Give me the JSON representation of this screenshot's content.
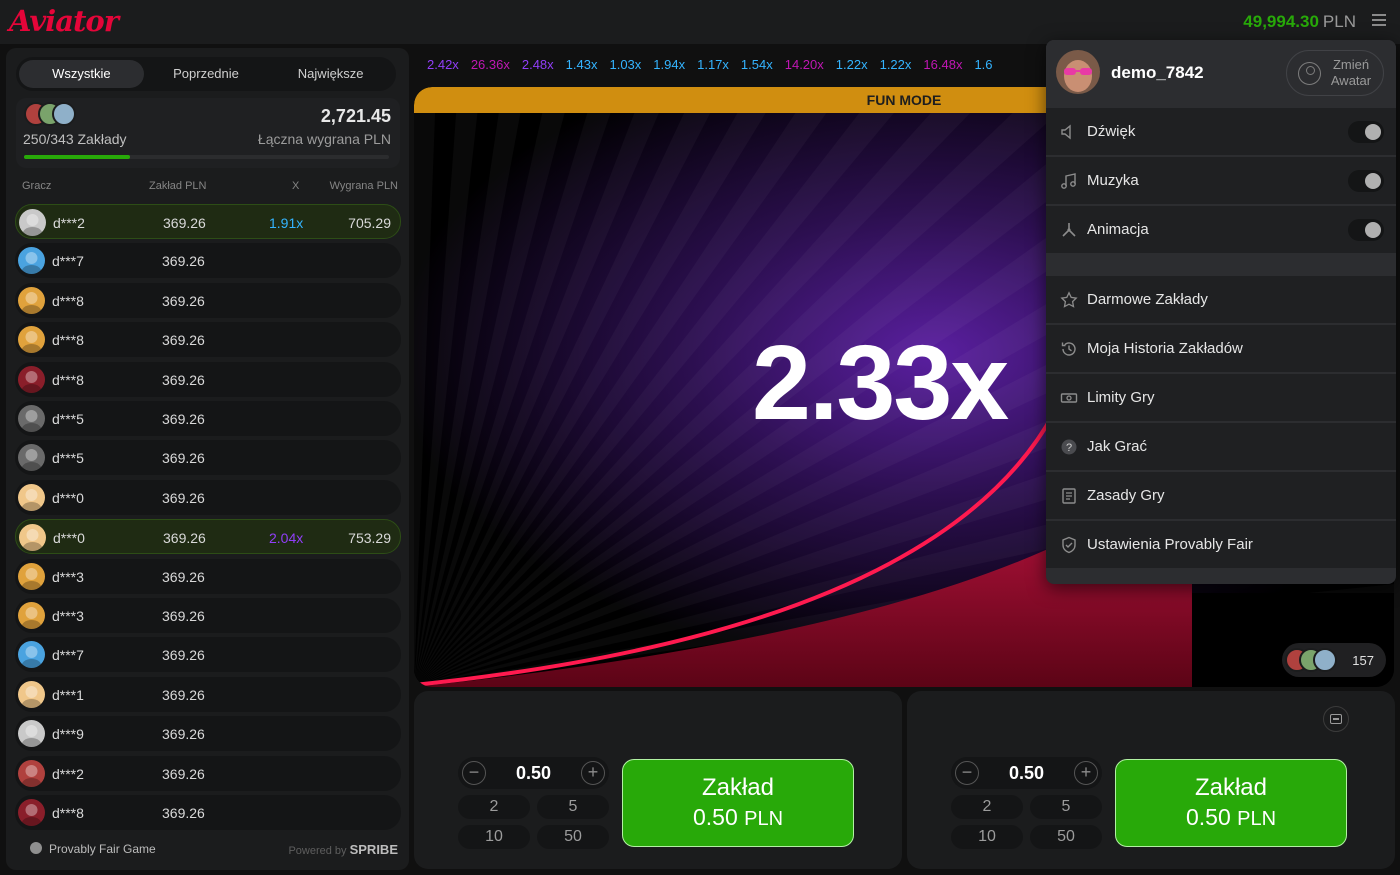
{
  "app": {
    "logo": "Aviator"
  },
  "header": {
    "balance": "49,994.30",
    "currency": "PLN"
  },
  "bets_panel": {
    "tabs": [
      {
        "label": "Wszystkie",
        "active": true
      },
      {
        "label": "Poprzednie",
        "active": false
      },
      {
        "label": "Największe",
        "active": false
      }
    ],
    "summary": {
      "bets_count": "250/343 Zakłady",
      "total_win": "2,721.45",
      "total_win_label": "Łączna wygrana PLN",
      "progress": 0.29
    },
    "columns": {
      "player": "Gracz",
      "bet": "Zakład PLN",
      "mult": "X",
      "win": "Wygrana PLN"
    },
    "rows": [
      {
        "name": "d***2",
        "bet": "369.26",
        "mult": "1.91x",
        "win": "705.29",
        "mult_color": "blue",
        "won": true,
        "avatar": "#c9c9c9"
      },
      {
        "name": "d***7",
        "bet": "369.26",
        "mult": "",
        "win": "",
        "won": false,
        "avatar": "#4aa3e0"
      },
      {
        "name": "d***8",
        "bet": "369.26",
        "mult": "",
        "win": "",
        "won": false,
        "avatar": "#e0a23c"
      },
      {
        "name": "d***8",
        "bet": "369.26",
        "mult": "",
        "win": "",
        "won": false,
        "avatar": "#e0a23c"
      },
      {
        "name": "d***8",
        "bet": "369.26",
        "mult": "",
        "win": "",
        "won": false,
        "avatar": "#8a1e2a"
      },
      {
        "name": "d***5",
        "bet": "369.26",
        "mult": "",
        "win": "",
        "won": false,
        "avatar": "#6a6a6a"
      },
      {
        "name": "d***5",
        "bet": "369.26",
        "mult": "",
        "win": "",
        "won": false,
        "avatar": "#6a6a6a"
      },
      {
        "name": "d***0",
        "bet": "369.26",
        "mult": "",
        "win": "",
        "won": false,
        "avatar": "#f0c78a"
      },
      {
        "name": "d***0",
        "bet": "369.26",
        "mult": "2.04x",
        "win": "753.29",
        "mult_color": "purple",
        "won": true,
        "avatar": "#f0c78a"
      },
      {
        "name": "d***3",
        "bet": "369.26",
        "mult": "",
        "win": "",
        "won": false,
        "avatar": "#e0a23c"
      },
      {
        "name": "d***3",
        "bet": "369.26",
        "mult": "",
        "win": "",
        "won": false,
        "avatar": "#e0a23c"
      },
      {
        "name": "d***7",
        "bet": "369.26",
        "mult": "",
        "win": "",
        "won": false,
        "avatar": "#4aa3e0"
      },
      {
        "name": "d***1",
        "bet": "369.26",
        "mult": "",
        "win": "",
        "won": false,
        "avatar": "#f0c78a"
      },
      {
        "name": "d***9",
        "bet": "369.26",
        "mult": "",
        "win": "",
        "won": false,
        "avatar": "#c9c9c9"
      },
      {
        "name": "d***2",
        "bet": "369.26",
        "mult": "",
        "win": "",
        "won": false,
        "avatar": "#b0413e"
      },
      {
        "name": "d***8",
        "bet": "369.26",
        "mult": "",
        "win": "",
        "won": false,
        "avatar": "#8a1e2a"
      }
    ],
    "footer": {
      "provably_fair": "Provably Fair Game",
      "powered_by": "Powered by",
      "brand": "SPRIBE"
    }
  },
  "history": [
    {
      "value": "2.42x",
      "color": "#913ef8"
    },
    {
      "value": "26.36x",
      "color": "#c017b4"
    },
    {
      "value": "2.48x",
      "color": "#913ef8"
    },
    {
      "value": "1.43x",
      "color": "#34b4ff"
    },
    {
      "value": "1.03x",
      "color": "#34b4ff"
    },
    {
      "value": "1.94x",
      "color": "#34b4ff"
    },
    {
      "value": "1.17x",
      "color": "#34b4ff"
    },
    {
      "value": "1.54x",
      "color": "#34b4ff"
    },
    {
      "value": "14.20x",
      "color": "#c017b4"
    },
    {
      "value": "1.22x",
      "color": "#34b4ff"
    },
    {
      "value": "1.22x",
      "color": "#34b4ff"
    },
    {
      "value": "16.48x",
      "color": "#c017b4"
    },
    {
      "value": "1.6",
      "color": "#34b4ff"
    }
  ],
  "game": {
    "mode_banner": "FUN MODE",
    "multiplier": "2.33x",
    "online_count": "157"
  },
  "bet_controls": [
    {
      "amount": "0.50",
      "quick": [
        "2",
        "5",
        "10",
        "50"
      ],
      "button_title": "Zakład",
      "button_amount": "0.50",
      "button_currency": "PLN"
    },
    {
      "amount": "0.50",
      "quick": [
        "2",
        "5",
        "10",
        "50"
      ],
      "button_title": "Zakład",
      "button_amount": "0.50",
      "button_currency": "PLN"
    }
  ],
  "menu": {
    "username": "demo_7842",
    "change_avatar": [
      "Zmień",
      "Awatar"
    ],
    "toggles": [
      {
        "label": "Dźwięk",
        "icon": "speaker-icon"
      },
      {
        "label": "Muzyka",
        "icon": "music-note-icon"
      },
      {
        "label": "Animacja",
        "icon": "propeller-icon"
      }
    ],
    "items": [
      {
        "label": "Darmowe Zakłady",
        "icon": "star-icon"
      },
      {
        "label": "Moja Historia Zakładów",
        "icon": "history-icon"
      },
      {
        "label": "Limity Gry",
        "icon": "banknote-icon"
      },
      {
        "label": "Jak Grać",
        "icon": "question-icon"
      },
      {
        "label": "Zasady Gry",
        "icon": "document-icon"
      },
      {
        "label": "Ustawienia Provably Fair",
        "icon": "shield-icon"
      }
    ]
  }
}
